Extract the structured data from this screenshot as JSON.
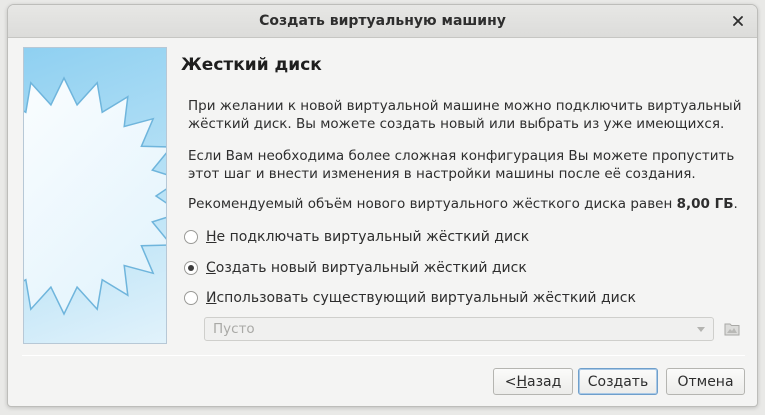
{
  "window": {
    "title": "Создать виртуальную машину"
  },
  "page": {
    "title": "Жесткий диск",
    "para1": "При желании к новой виртуальной машине можно подключить виртуальный жёсткий диск. Вы можете создать новый или выбрать из уже имеющихся.",
    "para2": "Если Вам необходима более сложная конфигурация Вы можете пропустить этот шаг и внести изменения в настройки машины после её создания.",
    "para3_prefix": "Рекомендуемый объём нового виртуального жёсткого диска равен ",
    "para3_size": "8,00 ГБ",
    "para3_suffix": "."
  },
  "options": [
    {
      "mnemonic": "Н",
      "rest": "е подключать виртуальный жёсткий диск",
      "checked": false
    },
    {
      "mnemonic": "С",
      "rest": "оздать новый виртуальный жёсткий диск",
      "checked": true
    },
    {
      "mnemonic": "И",
      "rest": "спользовать существующий виртуальный жёсткий диск",
      "checked": false
    }
  ],
  "existing_disk": {
    "selected": "Пусто",
    "enabled": false
  },
  "buttons": {
    "back_prefix": "< ",
    "back_mnemonic": "Н",
    "back_rest": "азад",
    "create": "Создать",
    "cancel": "Отмена"
  },
  "colors": {
    "accent": "#6f9fcb",
    "wizard_blue": "#8fd0f1"
  },
  "icons": {
    "close": "close-icon",
    "folder": "folder-icon",
    "dropdown": "chevron-down-icon"
  }
}
